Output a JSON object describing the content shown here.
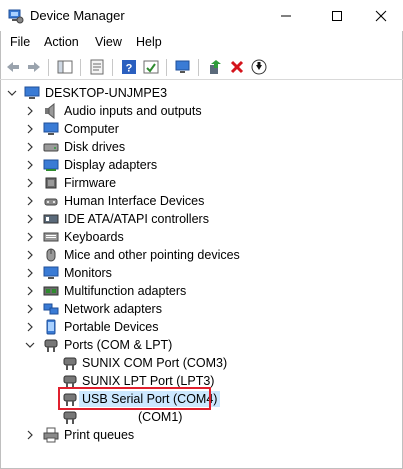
{
  "window": {
    "title": "Device Manager",
    "icon": "device-manager-icon"
  },
  "menu": [
    "File",
    "Action",
    "View",
    "Help"
  ],
  "toolbar": {
    "buttons": [
      "back-icon",
      "forward-icon",
      "properties-icon",
      "help-icon",
      "show-hidden-icon",
      "scan-icon",
      "update-driver-icon",
      "uninstall-icon",
      "download-icon"
    ]
  },
  "tree": {
    "root": "DESKTOP-UNJMPE3",
    "categories": [
      {
        "label": "Audio inputs and outputs",
        "icon": "speaker-icon"
      },
      {
        "label": "Computer",
        "icon": "monitor-icon"
      },
      {
        "label": "Disk drives",
        "icon": "disk-icon"
      },
      {
        "label": "Display adapters",
        "icon": "display-adapter-icon"
      },
      {
        "label": "Firmware",
        "icon": "chip-icon"
      },
      {
        "label": "Human Interface Devices",
        "icon": "hid-icon"
      },
      {
        "label": "IDE ATA/ATAPI controllers",
        "icon": "controller-icon"
      },
      {
        "label": "Keyboards",
        "icon": "keyboard-icon"
      },
      {
        "label": "Mice and other pointing devices",
        "icon": "mouse-icon"
      },
      {
        "label": "Monitors",
        "icon": "monitor-icon"
      },
      {
        "label": "Multifunction adapters",
        "icon": "multifunction-icon"
      },
      {
        "label": "Network adapters",
        "icon": "network-icon"
      },
      {
        "label": "Portable Devices",
        "icon": "portable-device-icon"
      },
      {
        "label": "Ports (COM & LPT)",
        "icon": "port-icon"
      }
    ],
    "ports_children": [
      "SUNIX COM Port (COM3)",
      "SUNIX LPT Port (LPT3)",
      "USB Serial Port (COM4)",
      "(COM1)"
    ],
    "after": {
      "label": "Print queues",
      "icon": "printer-icon"
    }
  },
  "colors": {
    "selection": "#cce8ff",
    "highlight_border": "#e0202e"
  }
}
